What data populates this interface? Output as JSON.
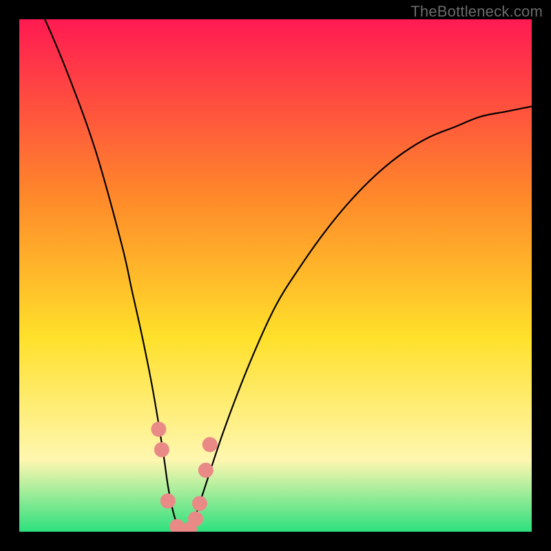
{
  "watermark": "TheBottleneck.com",
  "chart_data": {
    "type": "line",
    "title": "",
    "xlabel": "",
    "ylabel": "",
    "xlim": [
      0,
      100
    ],
    "ylim": [
      0,
      100
    ],
    "background_gradient": {
      "top": "#ff1a52",
      "upper_mid": "#ff8a2a",
      "mid": "#ffe02a",
      "lower_mid": "#fff7b0",
      "bottom": "#2ee07e"
    },
    "series": [
      {
        "name": "curve",
        "color": "#000000",
        "x": [
          0,
          5,
          10,
          15,
          20,
          22,
          24,
          26,
          28,
          29,
          30,
          31,
          32,
          33,
          34,
          36,
          40,
          45,
          50,
          55,
          60,
          65,
          70,
          75,
          80,
          85,
          90,
          95,
          100
        ],
        "values": [
          110,
          100,
          88,
          74,
          56,
          47,
          38,
          28,
          16,
          9,
          4,
          1,
          0,
          0,
          2,
          8,
          20,
          33,
          44,
          52,
          59,
          65,
          70,
          74,
          77,
          79,
          81,
          82,
          83
        ]
      }
    ],
    "markers": {
      "name": "bottleneck-markers",
      "color": "#e98a87",
      "points": [
        {
          "x": 27.2,
          "y": 20
        },
        {
          "x": 27.8,
          "y": 16
        },
        {
          "x": 29.0,
          "y": 6
        },
        {
          "x": 30.8,
          "y": 1
        },
        {
          "x": 32.0,
          "y": 0
        },
        {
          "x": 33.2,
          "y": 0.5
        },
        {
          "x": 34.4,
          "y": 2.5
        },
        {
          "x": 35.2,
          "y": 5.5
        },
        {
          "x": 36.4,
          "y": 12
        },
        {
          "x": 37.2,
          "y": 17
        }
      ]
    }
  }
}
